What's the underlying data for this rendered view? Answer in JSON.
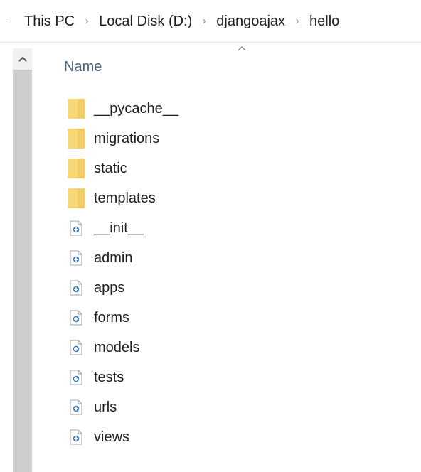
{
  "breadcrumb": {
    "items": [
      "This PC",
      "Local Disk (D:)",
      "djangoajax",
      "hello"
    ],
    "separator": "›"
  },
  "scrollbar": {
    "up_arrow": "^"
  },
  "columns": {
    "name_header": "Name",
    "sort_indicator": "^"
  },
  "files": [
    {
      "name": "__pycache__",
      "type": "folder",
      "icon": "folder-icon"
    },
    {
      "name": "migrations",
      "type": "folder",
      "icon": "folder-icon"
    },
    {
      "name": "static",
      "type": "folder",
      "icon": "folder-icon"
    },
    {
      "name": "templates",
      "type": "folder",
      "icon": "folder-icon"
    },
    {
      "name": "__init__",
      "type": "python",
      "icon": "python-file-icon"
    },
    {
      "name": "admin",
      "type": "python",
      "icon": "python-file-icon"
    },
    {
      "name": "apps",
      "type": "python",
      "icon": "python-file-icon"
    },
    {
      "name": "forms",
      "type": "python",
      "icon": "python-file-icon"
    },
    {
      "name": "models",
      "type": "python",
      "icon": "python-file-icon"
    },
    {
      "name": "tests",
      "type": "python",
      "icon": "python-file-icon"
    },
    {
      "name": "urls",
      "type": "python",
      "icon": "python-file-icon"
    },
    {
      "name": "views",
      "type": "python",
      "icon": "python-file-icon"
    }
  ],
  "colors": {
    "folder": "#f8d775",
    "folder_dark": "#e6b84c",
    "python_blue": "#3a76b5",
    "header_text": "#4c607a"
  }
}
